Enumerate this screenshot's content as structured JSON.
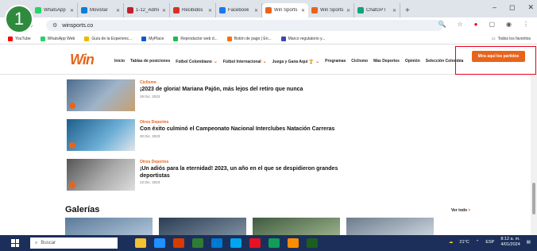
{
  "annotation_badge": "1",
  "browser": {
    "tabs": [
      {
        "label": "WhatsApp",
        "color": "#25d366",
        "active": false
      },
      {
        "label": "Movistar",
        "color": "#0b7fd3",
        "active": false
      },
      {
        "label": "1-12_Admi",
        "color": "#c0202a",
        "active": false
      },
      {
        "label": "Recibidos",
        "color": "#d93025",
        "active": false
      },
      {
        "label": "Facebook",
        "color": "#1877f2",
        "active": false
      },
      {
        "label": "Win Sports",
        "color": "#e8641b",
        "active": true
      },
      {
        "label": "Win Sports",
        "color": "#e8641b",
        "active": false
      },
      {
        "label": "ChatGPT",
        "color": "#10a37f",
        "active": false
      }
    ],
    "new_tab": "+",
    "window_controls": {
      "minimize": "–",
      "maximize": "◻",
      "close": "✕"
    },
    "url": "winsports.co",
    "bookmarks": [
      {
        "label": "YouTube",
        "color": "#ff0000"
      },
      {
        "label": "WhatsApp Web",
        "color": "#25d366"
      },
      {
        "label": "Guía de la Experienc...",
        "color": "#f4b400"
      },
      {
        "label": "MyPlace",
        "color": "#0b57d0"
      },
      {
        "label": "Reproductor web d...",
        "color": "#1db954"
      },
      {
        "label": "Botón de pago | En...",
        "color": "#ff6f00"
      },
      {
        "label": "Marco regulatorio y...",
        "color": "#3949ab"
      }
    ],
    "all_bookmarks": "Todos los favoritos"
  },
  "site": {
    "logo": "Win",
    "nav": [
      {
        "label": "Inicio",
        "chevron": false
      },
      {
        "label": "Tablas de posiciones",
        "chevron": false
      },
      {
        "label": "Fútbol Colombiano",
        "chevron": true
      },
      {
        "label": "Fútbol Internacional",
        "chevron": true
      },
      {
        "label": "Juega y Gana Aquí 🏆",
        "chevron": true
      },
      {
        "label": "Programas",
        "chevron": false
      },
      {
        "label": "Ciclismo",
        "chevron": false
      },
      {
        "label": "Más Deportes",
        "chevron": false
      },
      {
        "label": "Opinión",
        "chevron": false
      },
      {
        "label": "Selección Colombia",
        "chevron": false
      }
    ],
    "cta": "Mira aquí los partidos",
    "articles": [
      {
        "category": "Ciclismo",
        "headline": "¡2023 de gloria! Mariana Pajón, más lejos del retiro que nunca",
        "date": "29 Dic. 2023"
      },
      {
        "category": "Otros Deportes",
        "headline": "Con éxito culminó el Campeonato Nacional Interclubes Natación Carreras",
        "date": "30 Dic. 2023"
      },
      {
        "category": "Otros Deportes",
        "headline": "¡Un adiós para la eternidad! 2023, un año en el que se despidieron grandes deportistas",
        "date": "23 Dic. 2023"
      }
    ],
    "galleries_title": "Galerías",
    "see_all": "Ver todo",
    "see_all_arrow": ">"
  },
  "taskbar": {
    "search_placeholder": "Buscar",
    "apps": [
      "#f2c233",
      "#1e90ff",
      "#d83b01",
      "#2e7d32",
      "#0078d4",
      "#00a4ef",
      "#e81123",
      "#0f9d58",
      "#ff8c00",
      "#1b5e20"
    ],
    "weather": "21°C",
    "language": "ESP",
    "time": "8:12 a. m.",
    "date": "4/01/2024"
  }
}
